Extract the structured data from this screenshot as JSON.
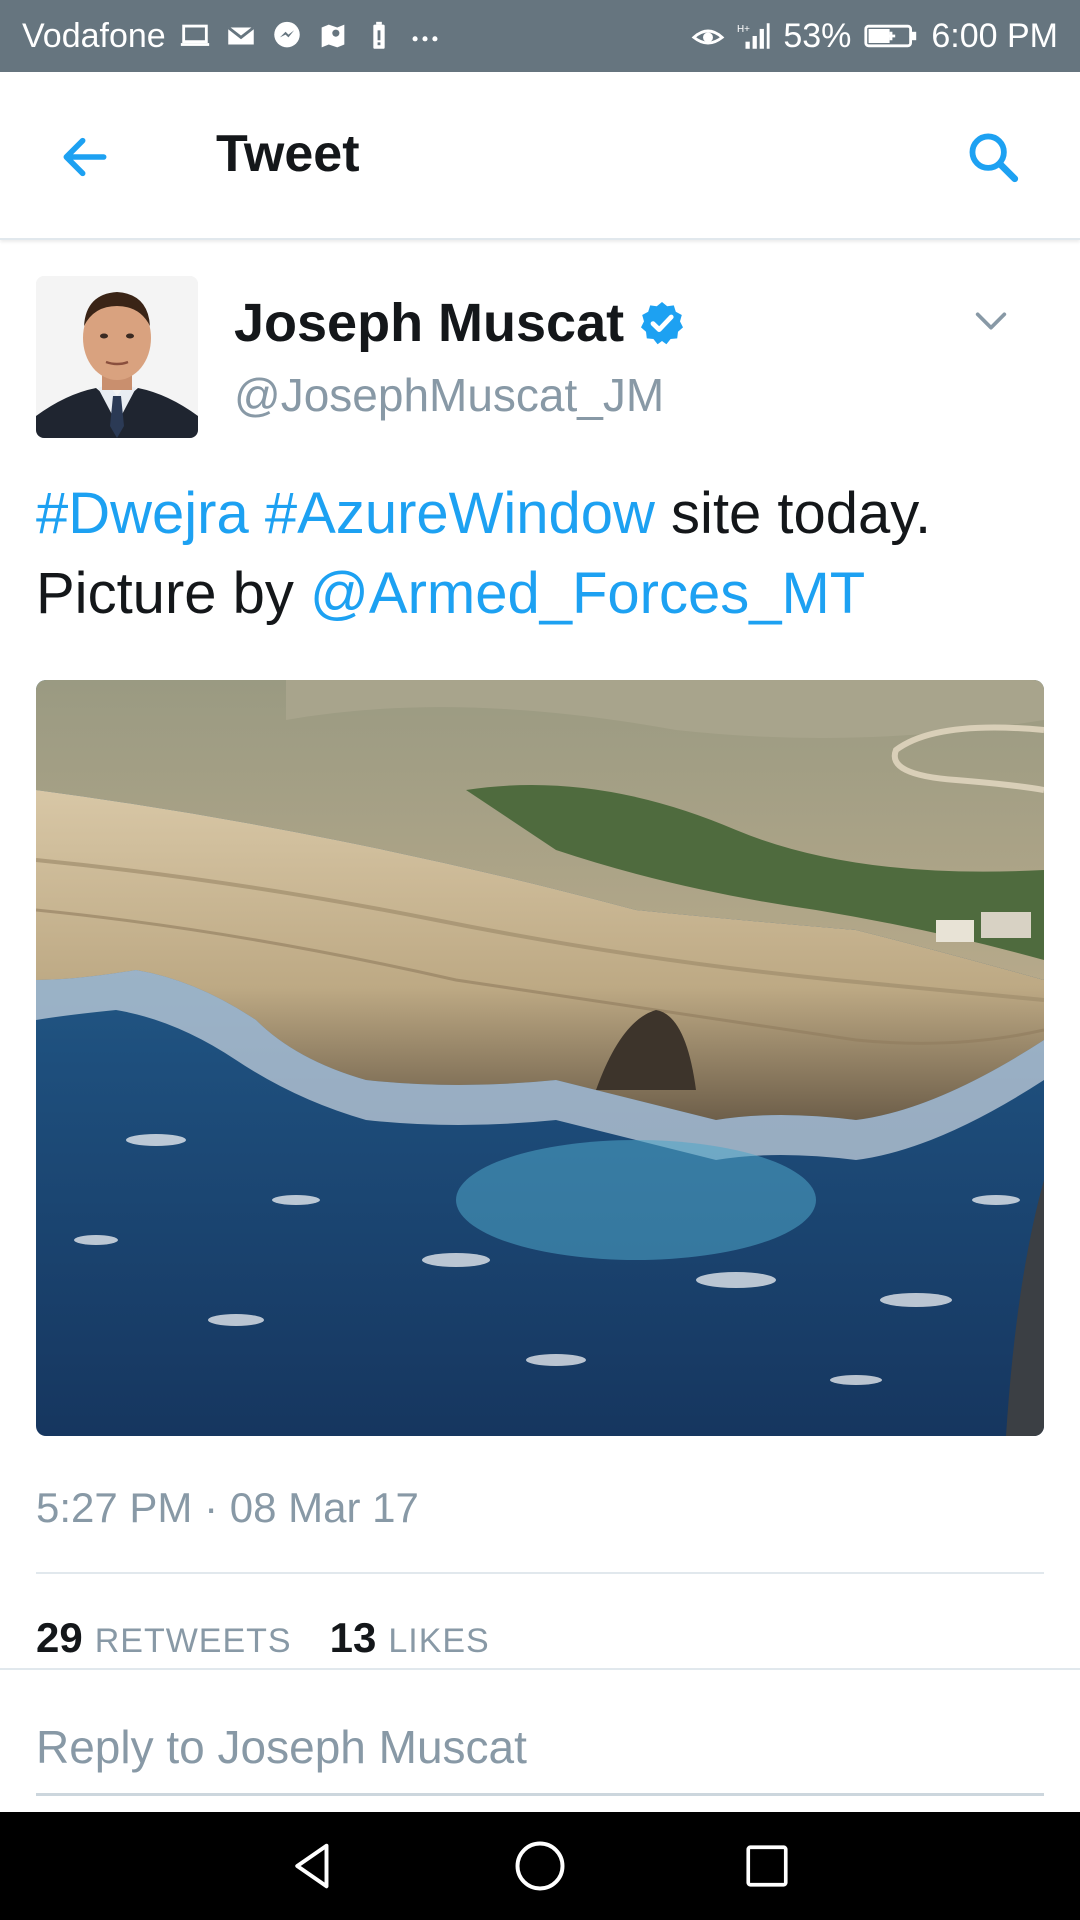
{
  "status_bar": {
    "carrier": "Vodafone",
    "battery_percent": "53%",
    "time": "6:00 PM",
    "left_icons": [
      "laptop-icon",
      "mail-icon",
      "messenger-icon",
      "maps-icon",
      "battery-alert-icon",
      "more-icon"
    ],
    "right_icons": [
      "eye-icon",
      "signal-icon",
      "battery-icon"
    ]
  },
  "app_bar": {
    "title": "Tweet",
    "back_icon": "arrow-left-icon",
    "search_icon": "search-icon"
  },
  "tweet": {
    "author_name": "Joseph Muscat",
    "verified": true,
    "handle": "@JosephMuscat_JM",
    "text_parts": {
      "hashtag1": "#Dwejra",
      "hashtag2": "#AzureWindow",
      "plain1": " site today.",
      "plain2": "Picture by ",
      "mention": "@Armed_Forces_MT"
    },
    "timestamp": "5:27 PM · 08 Mar 17",
    "retweets_count": "29",
    "retweets_label": "RETWEETS",
    "likes_count": "13",
    "likes_label": "LIKES"
  },
  "reply": {
    "placeholder": "Reply to Joseph Muscat"
  },
  "colors": {
    "link": "#1da1f2",
    "status_bar": "#66757f",
    "text": "#14171a",
    "muted": "#8899a6"
  }
}
